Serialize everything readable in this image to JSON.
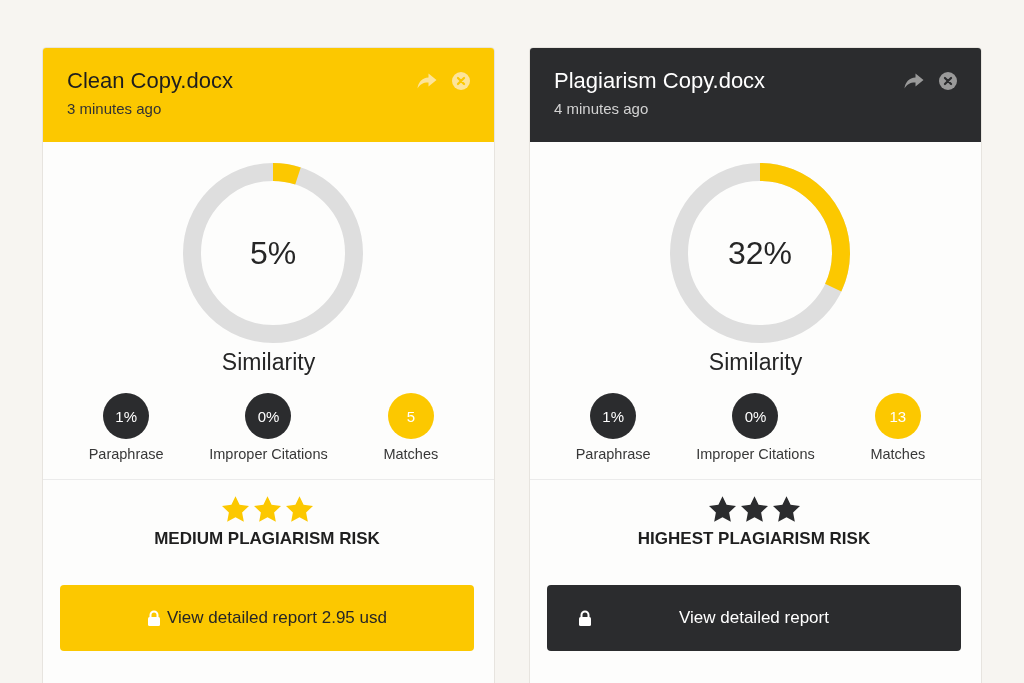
{
  "cards": [
    {
      "kind": "clean",
      "title": "Clean Copy.docx",
      "time": "3 minutes ago",
      "similarity": {
        "level": 0.05,
        "reading": "5%",
        "label": "Similarity"
      },
      "stats": [
        {
          "value": "1%",
          "label": "Paraphrase",
          "color": "#2b2c2e"
        },
        {
          "value": "0%",
          "label": "Improper Citations",
          "color": "#2b2c2e"
        },
        {
          "value": "5",
          "label": "Matches",
          "color": "#fcc800"
        }
      ],
      "stars": 3,
      "risk": "MEDIUM PLAGIARISM RISK",
      "report_button": "View detailed report 2.95 usd"
    },
    {
      "kind": "flagged",
      "title": "Plagiarism Copy.docx",
      "time": "4 minutes ago",
      "similarity": {
        "level": 0.32,
        "reading": "32%",
        "label": "Similarity"
      },
      "stats": [
        {
          "value": "1%",
          "label": "Paraphrase",
          "color": "#2b2c2e"
        },
        {
          "value": "0%",
          "label": "Improper Citations",
          "color": "#2b2c2e"
        },
        {
          "value": "13",
          "label": "Matches",
          "color": "#fcc800"
        }
      ],
      "stars": 3,
      "risk": "HIGHEST PLAGIARISM RISK",
      "report_button": "View detailed report"
    }
  ]
}
